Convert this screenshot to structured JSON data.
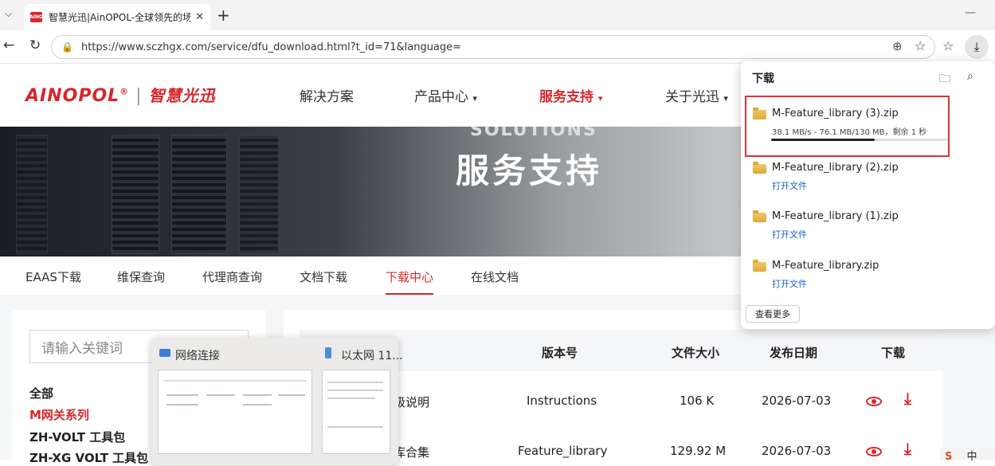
{
  "browser": {
    "tab_title": "智慧光迅|AinOPOL-全球领先的场景",
    "tab_icon_text": "AINO",
    "url": "https://www.sczhgx.com/service/dfu_download.html?t_id=71&language="
  },
  "site": {
    "logo_en": "AINOPOL",
    "logo_reg": "®",
    "logo_sep": "|",
    "logo_cn": "智慧光迅",
    "nav": [
      {
        "label": "解决方案"
      },
      {
        "label": "产品中心"
      },
      {
        "label": "服务支持"
      },
      {
        "label": "关于光迅"
      }
    ],
    "banner_en": "SOLUTIONS",
    "banner_cn": "服务支持",
    "subtabs": [
      {
        "label": "EAAS下载"
      },
      {
        "label": "维保查询"
      },
      {
        "label": "代理商查询"
      },
      {
        "label": "文档下载"
      },
      {
        "label": "下载中心"
      },
      {
        "label": "在线文档"
      }
    ],
    "search_placeholder": "请输入关键词",
    "categories": [
      {
        "label": "全部"
      },
      {
        "label": "M网关系列"
      },
      {
        "label": "ZH-VOLT 工具包"
      },
      {
        "label": "ZH-XG VOLT 工具包"
      }
    ],
    "table": {
      "headers": {
        "version": "版本号",
        "size": "文件大小",
        "date": "发布日期",
        "download": "下载"
      },
      "rows": [
        {
          "name_partial": "级说明",
          "version": "Instructions",
          "size": "106 K",
          "date": "2026-07-03"
        },
        {
          "name_partial": "库合集",
          "version": "Feature_library",
          "size": "129.92 M",
          "date": "2026-07-03"
        }
      ]
    }
  },
  "preview": {
    "window1": "网络连接",
    "window2": "以太网 11..."
  },
  "downloads": {
    "title": "下载",
    "items": [
      {
        "name": "M-Feature_library (3).zip",
        "status": "38.1 MB/s - 76.1 MB/130 MB，剩余 1 秒",
        "progress": 0.585
      },
      {
        "name": "M-Feature_library (2).zip",
        "action": "打开文件"
      },
      {
        "name": "M-Feature_library (1).zip",
        "action": "打开文件"
      },
      {
        "name": "M-Feature_library.zip",
        "action": "打开文件"
      }
    ],
    "more": "查看更多"
  },
  "ime": {
    "label": "中"
  }
}
